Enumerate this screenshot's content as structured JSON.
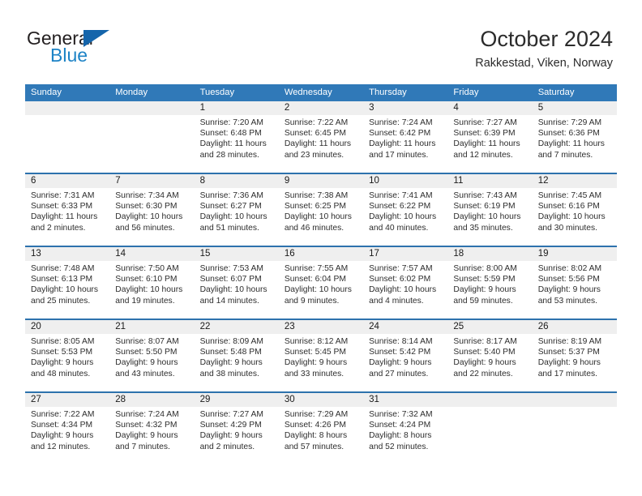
{
  "brand": {
    "word_one": "General",
    "word_two": "Blue",
    "triangle_color": "#1565AB",
    "blue_text_color": "#1D83C6"
  },
  "header": {
    "title": "October 2024",
    "subtitle": "Rakkestad, Viken, Norway"
  },
  "theme": {
    "header_blue": "#3079B8",
    "separator_blue": "#2D72AD",
    "number_band_gray": "#EFEFEF"
  },
  "weekday_headers": [
    "Sunday",
    "Monday",
    "Tuesday",
    "Wednesday",
    "Thursday",
    "Friday",
    "Saturday"
  ],
  "weeks": [
    [
      {
        "day": "",
        "lines": []
      },
      {
        "day": "",
        "lines": []
      },
      {
        "day": "1",
        "lines": [
          "Sunrise: 7:20 AM",
          "Sunset: 6:48 PM",
          "Daylight: 11 hours",
          "and 28 minutes."
        ]
      },
      {
        "day": "2",
        "lines": [
          "Sunrise: 7:22 AM",
          "Sunset: 6:45 PM",
          "Daylight: 11 hours",
          "and 23 minutes."
        ]
      },
      {
        "day": "3",
        "lines": [
          "Sunrise: 7:24 AM",
          "Sunset: 6:42 PM",
          "Daylight: 11 hours",
          "and 17 minutes."
        ]
      },
      {
        "day": "4",
        "lines": [
          "Sunrise: 7:27 AM",
          "Sunset: 6:39 PM",
          "Daylight: 11 hours",
          "and 12 minutes."
        ]
      },
      {
        "day": "5",
        "lines": [
          "Sunrise: 7:29 AM",
          "Sunset: 6:36 PM",
          "Daylight: 11 hours",
          "and 7 minutes."
        ]
      }
    ],
    [
      {
        "day": "6",
        "lines": [
          "Sunrise: 7:31 AM",
          "Sunset: 6:33 PM",
          "Daylight: 11 hours",
          "and 2 minutes."
        ]
      },
      {
        "day": "7",
        "lines": [
          "Sunrise: 7:34 AM",
          "Sunset: 6:30 PM",
          "Daylight: 10 hours",
          "and 56 minutes."
        ]
      },
      {
        "day": "8",
        "lines": [
          "Sunrise: 7:36 AM",
          "Sunset: 6:27 PM",
          "Daylight: 10 hours",
          "and 51 minutes."
        ]
      },
      {
        "day": "9",
        "lines": [
          "Sunrise: 7:38 AM",
          "Sunset: 6:25 PM",
          "Daylight: 10 hours",
          "and 46 minutes."
        ]
      },
      {
        "day": "10",
        "lines": [
          "Sunrise: 7:41 AM",
          "Sunset: 6:22 PM",
          "Daylight: 10 hours",
          "and 40 minutes."
        ]
      },
      {
        "day": "11",
        "lines": [
          "Sunrise: 7:43 AM",
          "Sunset: 6:19 PM",
          "Daylight: 10 hours",
          "and 35 minutes."
        ]
      },
      {
        "day": "12",
        "lines": [
          "Sunrise: 7:45 AM",
          "Sunset: 6:16 PM",
          "Daylight: 10 hours",
          "and 30 minutes."
        ]
      }
    ],
    [
      {
        "day": "13",
        "lines": [
          "Sunrise: 7:48 AM",
          "Sunset: 6:13 PM",
          "Daylight: 10 hours",
          "and 25 minutes."
        ]
      },
      {
        "day": "14",
        "lines": [
          "Sunrise: 7:50 AM",
          "Sunset: 6:10 PM",
          "Daylight: 10 hours",
          "and 19 minutes."
        ]
      },
      {
        "day": "15",
        "lines": [
          "Sunrise: 7:53 AM",
          "Sunset: 6:07 PM",
          "Daylight: 10 hours",
          "and 14 minutes."
        ]
      },
      {
        "day": "16",
        "lines": [
          "Sunrise: 7:55 AM",
          "Sunset: 6:04 PM",
          "Daylight: 10 hours",
          "and 9 minutes."
        ]
      },
      {
        "day": "17",
        "lines": [
          "Sunrise: 7:57 AM",
          "Sunset: 6:02 PM",
          "Daylight: 10 hours",
          "and 4 minutes."
        ]
      },
      {
        "day": "18",
        "lines": [
          "Sunrise: 8:00 AM",
          "Sunset: 5:59 PM",
          "Daylight: 9 hours",
          "and 59 minutes."
        ]
      },
      {
        "day": "19",
        "lines": [
          "Sunrise: 8:02 AM",
          "Sunset: 5:56 PM",
          "Daylight: 9 hours",
          "and 53 minutes."
        ]
      }
    ],
    [
      {
        "day": "20",
        "lines": [
          "Sunrise: 8:05 AM",
          "Sunset: 5:53 PM",
          "Daylight: 9 hours",
          "and 48 minutes."
        ]
      },
      {
        "day": "21",
        "lines": [
          "Sunrise: 8:07 AM",
          "Sunset: 5:50 PM",
          "Daylight: 9 hours",
          "and 43 minutes."
        ]
      },
      {
        "day": "22",
        "lines": [
          "Sunrise: 8:09 AM",
          "Sunset: 5:48 PM",
          "Daylight: 9 hours",
          "and 38 minutes."
        ]
      },
      {
        "day": "23",
        "lines": [
          "Sunrise: 8:12 AM",
          "Sunset: 5:45 PM",
          "Daylight: 9 hours",
          "and 33 minutes."
        ]
      },
      {
        "day": "24",
        "lines": [
          "Sunrise: 8:14 AM",
          "Sunset: 5:42 PM",
          "Daylight: 9 hours",
          "and 27 minutes."
        ]
      },
      {
        "day": "25",
        "lines": [
          "Sunrise: 8:17 AM",
          "Sunset: 5:40 PM",
          "Daylight: 9 hours",
          "and 22 minutes."
        ]
      },
      {
        "day": "26",
        "lines": [
          "Sunrise: 8:19 AM",
          "Sunset: 5:37 PM",
          "Daylight: 9 hours",
          "and 17 minutes."
        ]
      }
    ],
    [
      {
        "day": "27",
        "lines": [
          "Sunrise: 7:22 AM",
          "Sunset: 4:34 PM",
          "Daylight: 9 hours",
          "and 12 minutes."
        ]
      },
      {
        "day": "28",
        "lines": [
          "Sunrise: 7:24 AM",
          "Sunset: 4:32 PM",
          "Daylight: 9 hours",
          "and 7 minutes."
        ]
      },
      {
        "day": "29",
        "lines": [
          "Sunrise: 7:27 AM",
          "Sunset: 4:29 PM",
          "Daylight: 9 hours",
          "and 2 minutes."
        ]
      },
      {
        "day": "30",
        "lines": [
          "Sunrise: 7:29 AM",
          "Sunset: 4:26 PM",
          "Daylight: 8 hours",
          "and 57 minutes."
        ]
      },
      {
        "day": "31",
        "lines": [
          "Sunrise: 7:32 AM",
          "Sunset: 4:24 PM",
          "Daylight: 8 hours",
          "and 52 minutes."
        ]
      },
      {
        "day": "",
        "lines": []
      },
      {
        "day": "",
        "lines": []
      }
    ]
  ]
}
